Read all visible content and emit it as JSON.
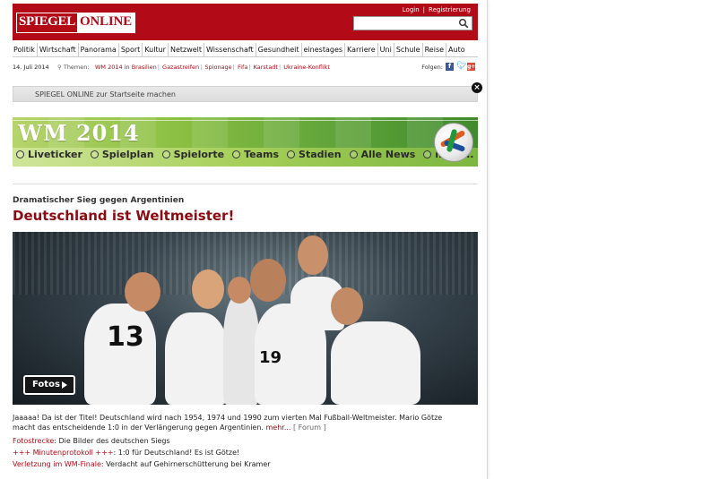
{
  "header": {
    "logo_left": "SPIEGEL",
    "logo_right": "ONLINE",
    "login": "Login",
    "separator": "|",
    "register": "Registrierung",
    "search_placeholder": ""
  },
  "nav": [
    "Politik",
    "Wirtschaft",
    "Panorama",
    "Sport",
    "Kultur",
    "Netzwelt",
    "Wissenschaft",
    "Gesundheit",
    "einestages",
    "Karriere",
    "Uni",
    "Schule",
    "Reise",
    "Auto"
  ],
  "subnav": {
    "date": "14. Juli 2014",
    "themen_label": "Themen:",
    "topics": [
      "WM 2014 in Brasilien",
      "Gazastreifen",
      "Spionage",
      "Fifa",
      "Karstadt",
      "Ukraine-Konflikt"
    ],
    "folgen": "Folgen:"
  },
  "startbar": {
    "text": "SPIEGEL ONLINE zur Startseite machen",
    "close": "×"
  },
  "banner": {
    "title": "WM 2014",
    "menu": [
      "Liveticker",
      "Spielplan",
      "Spielorte",
      "Teams",
      "Stadien",
      "Alle News",
      "mehr..."
    ]
  },
  "article": {
    "kicker": "Dramatischer Sieg gegen Argentinien",
    "headline": "Deutschland ist Weltmeister!",
    "fotos_button": "Fotos",
    "teaser": "Jaaaaa! Da ist der Titel! Deutschland wird nach 1954, 1974 und 1990 zum vierten Mal Fußball-Weltmeister. Mario Götze macht das entscheidende 1:0 in der Verlängerung gegen Argentinien.",
    "more": "mehr...",
    "forum": "[ Forum ]"
  },
  "related": [
    {
      "label": "Fotostrecke:",
      "text": "Die Bilder des deutschen Siegs"
    },
    {
      "label": "+++ Minutenprotokoll +++:",
      "text": "1:0 für Deutschland! Es ist Götze!"
    },
    {
      "label": "Verletzung im WM-Finale:",
      "text": "Verdacht auf Gehirnerschütterung bei Kramer"
    }
  ],
  "colors": {
    "brand": "#b20a16",
    "headline": "#8c0b12"
  }
}
